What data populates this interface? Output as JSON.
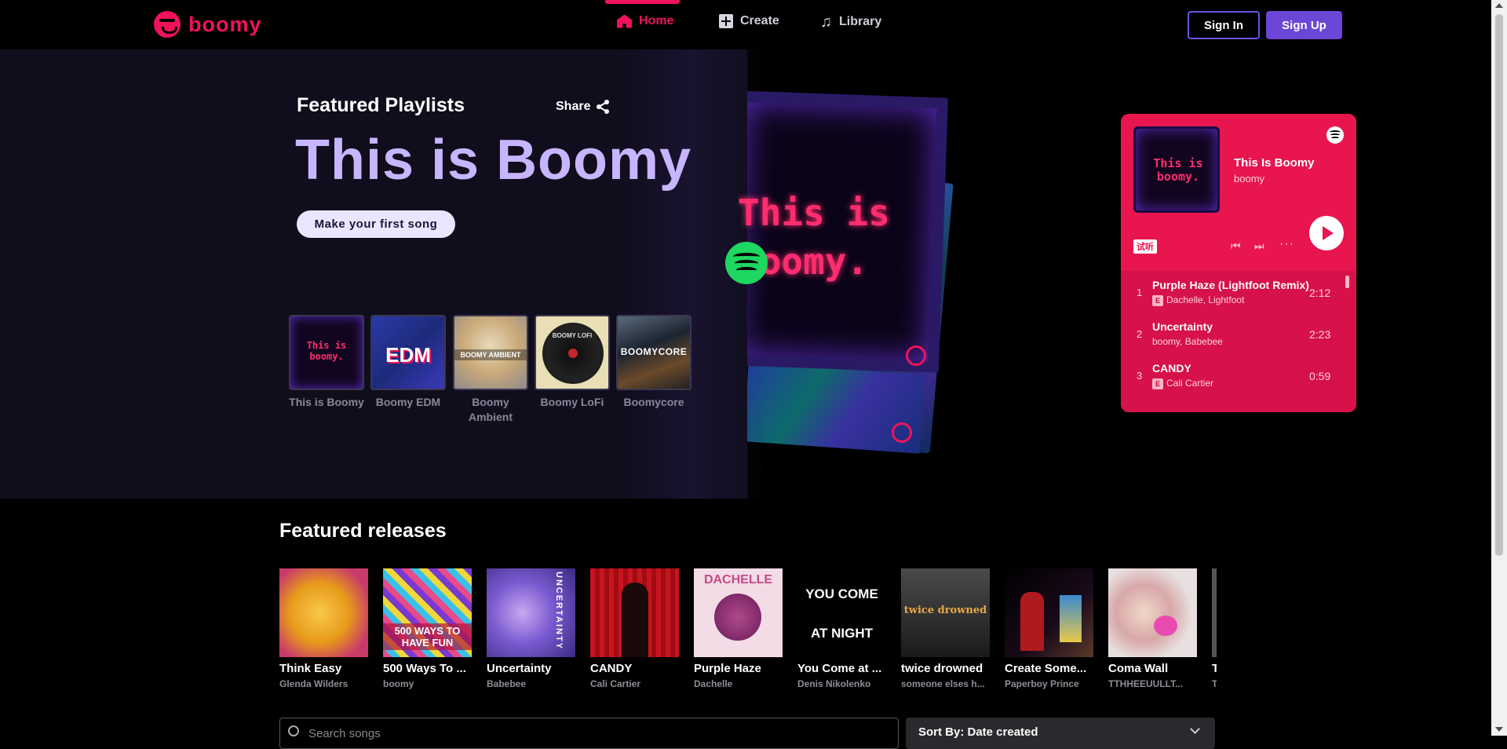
{
  "header": {
    "logo_text": "boomy",
    "nav": [
      {
        "label": "Home",
        "icon": "home-icon",
        "active": true
      },
      {
        "label": "Create",
        "icon": "plus-square-icon",
        "active": false
      },
      {
        "label": "Library",
        "icon": "music-note-icon",
        "active": false
      }
    ],
    "sign_in": "Sign In",
    "sign_up": "Sign Up"
  },
  "hero": {
    "featured_label": "Featured Playlists",
    "share_label": "Share",
    "title": "This is Boomy",
    "cta": "Make your first song",
    "art_text": "This is boomy.",
    "playlists": [
      {
        "name": "This is Boomy",
        "cover_text": "This is boomy."
      },
      {
        "name": "Boomy EDM",
        "cover_text": "EDM"
      },
      {
        "name": "Boomy Ambient",
        "cover_text": "BOOMY AMBIENT"
      },
      {
        "name": "Boomy LoFi",
        "cover_text": "BOOMY LOFI"
      },
      {
        "name": "Boomycore",
        "cover_text": "BOOMYCORE"
      }
    ]
  },
  "spotify_widget": {
    "cover_text": "This is boomy.",
    "title": "This Is Boomy",
    "artist": "boomy",
    "preview_label": "试听",
    "tracks": [
      {
        "num": "1",
        "title": "Purple Haze (Lightfoot Remix)",
        "artist": "Dachelle, Lightfoot",
        "explicit": "E",
        "duration": "2:12"
      },
      {
        "num": "2",
        "title": "Uncertainty",
        "artist": "boomy, Babebee",
        "explicit": "",
        "duration": "2:23"
      },
      {
        "num": "3",
        "title": "CANDY",
        "artist": "Cali Cartier",
        "explicit": "E",
        "duration": "0:59"
      }
    ]
  },
  "releases": {
    "title": "Featured releases",
    "items": [
      {
        "title": "Think Easy",
        "artist": "Glenda Wilders",
        "cover_text": ""
      },
      {
        "title": "500 Ways To ...",
        "artist": "boomy",
        "cover_text": "500 WAYS TO HAVE FUN"
      },
      {
        "title": "Uncertainty",
        "artist": "Babebee",
        "cover_text": "UNCERTAINTY"
      },
      {
        "title": "CANDY",
        "artist": "Cali Cartier",
        "cover_text": ""
      },
      {
        "title": "Purple Haze",
        "artist": "Dachelle",
        "cover_text": "DACHELLE"
      },
      {
        "title": "You Come at ...",
        "artist": "Denis Nikolenko",
        "cover_text": "YOU COME AT NIGHT"
      },
      {
        "title": "twice drowned",
        "artist": "someone elses h...",
        "cover_text": "twice drowned"
      },
      {
        "title": "Create Some...",
        "artist": "Paperboy Prince",
        "cover_text": ""
      },
      {
        "title": "Coma Wall",
        "artist": "TTHHEEUULLT...",
        "cover_text": ""
      },
      {
        "title": "T",
        "artist": "T",
        "cover_text": ""
      }
    ]
  },
  "search": {
    "placeholder": "Search songs"
  },
  "sort": {
    "label": "Sort By: Date created"
  },
  "colors": {
    "brand": "#f0135a",
    "accent_purple": "#6c46d6",
    "hero_title": "#c7b5ff",
    "spotify_green": "#1ed760",
    "spotify_widget": "#e8154f"
  }
}
